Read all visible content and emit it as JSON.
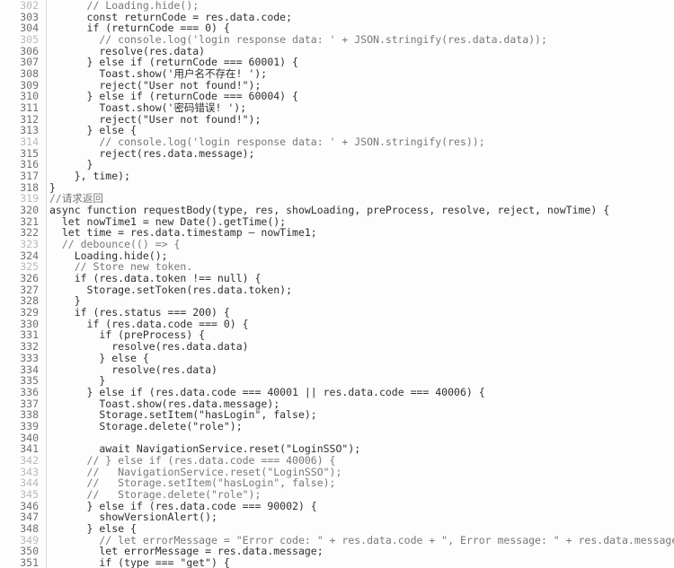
{
  "editor": {
    "kind": "code-editor",
    "language": "javascript",
    "background_color": "#fdfdfd",
    "text_color": "#2f2f33",
    "comment_color": "#787878",
    "gutter_color": "#707070",
    "gutter_dim_color": "#b9b9b9",
    "gutter_border_color": "#dcdcdc",
    "first_visible_line": 302,
    "last_visible_line": 351
  },
  "lines": [
    {
      "n": "302",
      "text": "      // Loading.hide();",
      "comment": true
    },
    {
      "n": "303",
      "text": "      const returnCode = res.data.code;",
      "comment": false
    },
    {
      "n": "304",
      "text": "      if (returnCode === 0) {",
      "comment": false
    },
    {
      "n": "305",
      "text": "        // console.log('login response data: ' + JSON.stringify(res.data.data));",
      "comment": true
    },
    {
      "n": "306",
      "text": "        resolve(res.data)",
      "comment": false
    },
    {
      "n": "307",
      "text": "      } else if (returnCode === 60001) {",
      "comment": false
    },
    {
      "n": "308",
      "text": "        Toast.show('用户名不存在! ');",
      "comment": false
    },
    {
      "n": "309",
      "text": "        reject(\"User not found!\");",
      "comment": false
    },
    {
      "n": "310",
      "text": "      } else if (returnCode === 60004) {",
      "comment": false
    },
    {
      "n": "311",
      "text": "        Toast.show('密码错误! ');",
      "comment": false
    },
    {
      "n": "312",
      "text": "        reject(\"User not found!\");",
      "comment": false
    },
    {
      "n": "313",
      "text": "      } else {",
      "comment": false
    },
    {
      "n": "314",
      "text": "        // console.log('login response data: ' + JSON.stringify(res));",
      "comment": true
    },
    {
      "n": "315",
      "text": "        reject(res.data.message);",
      "comment": false
    },
    {
      "n": "316",
      "text": "      }",
      "comment": false
    },
    {
      "n": "317",
      "text": "    }, time);",
      "comment": false
    },
    {
      "n": "318",
      "text": "}",
      "comment": false
    },
    {
      "n": "319",
      "text": "//请求返回",
      "comment": true
    },
    {
      "n": "320",
      "text": "async function requestBody(type, res, showLoading, preProcess, resolve, reject, nowTime) {",
      "comment": false
    },
    {
      "n": "321",
      "text": "  let nowTime1 = new Date().getTime();",
      "comment": false
    },
    {
      "n": "322",
      "text": "  let time = res.data.timestamp – nowTime1;",
      "comment": false
    },
    {
      "n": "323",
      "text": "  // debounce(() => {",
      "comment": true
    },
    {
      "n": "324",
      "text": "    Loading.hide();",
      "comment": false
    },
    {
      "n": "325",
      "text": "    // Store new token.",
      "comment": true
    },
    {
      "n": "326",
      "text": "    if (res.data.token !== null) {",
      "comment": false
    },
    {
      "n": "327",
      "text": "      Storage.setToken(res.data.token);",
      "comment": false
    },
    {
      "n": "328",
      "text": "    }",
      "comment": false
    },
    {
      "n": "329",
      "text": "    if (res.status === 200) {",
      "comment": false
    },
    {
      "n": "330",
      "text": "      if (res.data.code === 0) {",
      "comment": false
    },
    {
      "n": "331",
      "text": "        if (preProcess) {",
      "comment": false
    },
    {
      "n": "332",
      "text": "          resolve(res.data.data)",
      "comment": false
    },
    {
      "n": "333",
      "text": "        } else {",
      "comment": false
    },
    {
      "n": "334",
      "text": "          resolve(res.data)",
      "comment": false
    },
    {
      "n": "335",
      "text": "        }",
      "comment": false
    },
    {
      "n": "336",
      "text": "      } else if (res.data.code === 40001 || res.data.code === 40006) {",
      "comment": false
    },
    {
      "n": "337",
      "text": "        Toast.show(res.data.message);",
      "comment": false
    },
    {
      "n": "338",
      "text": "        Storage.setItem(\"hasLogin\", false);",
      "comment": false
    },
    {
      "n": "339",
      "text": "        Storage.delete(\"role\");",
      "comment": false
    },
    {
      "n": "340",
      "text": "",
      "comment": false
    },
    {
      "n": "341",
      "text": "        await NavigationService.reset(\"LoginSSO\");",
      "comment": false
    },
    {
      "n": "342",
      "text": "      // } else if (res.data.code === 40006) {",
      "comment": true
    },
    {
      "n": "343",
      "text": "      //   NavigationService.reset(\"LoginSSO\");",
      "comment": true
    },
    {
      "n": "344",
      "text": "      //   Storage.setItem(\"hasLogin\", false);",
      "comment": true
    },
    {
      "n": "345",
      "text": "      //   Storage.delete(\"role\");",
      "comment": true
    },
    {
      "n": "346",
      "text": "      } else if (res.data.code === 90002) {",
      "comment": false
    },
    {
      "n": "347",
      "text": "        showVersionAlert();",
      "comment": false
    },
    {
      "n": "348",
      "text": "      } else {",
      "comment": false
    },
    {
      "n": "349",
      "text": "        // let errorMessage = \"Error code: \" + res.data.code + \", Error message: \" + res.data.message",
      "comment": true
    },
    {
      "n": "350",
      "text": "        let errorMessage = res.data.message;",
      "comment": false
    },
    {
      "n": "351",
      "text": "        if (type === \"get\") {",
      "comment": false
    }
  ]
}
